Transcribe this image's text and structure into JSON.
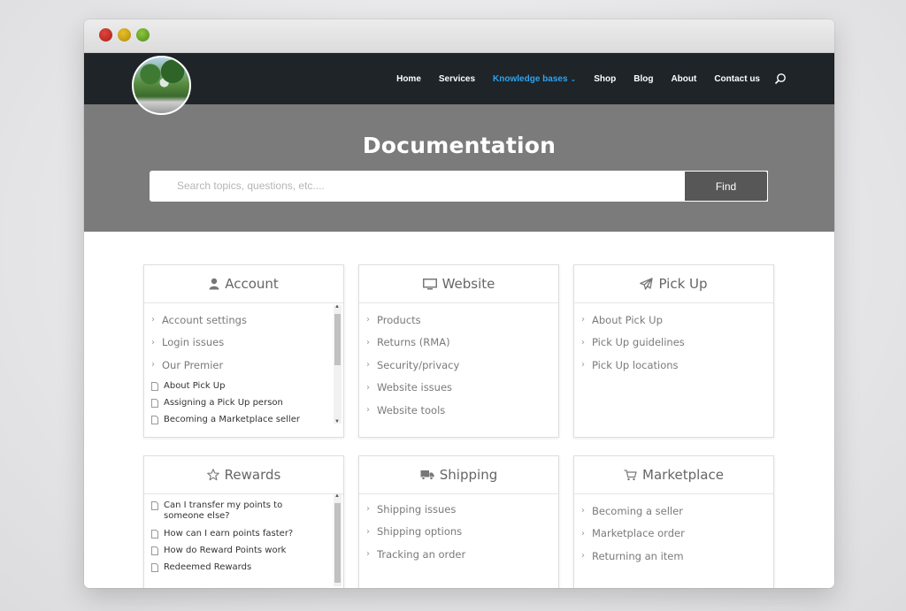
{
  "nav": {
    "items": [
      {
        "label": "Home",
        "active": false
      },
      {
        "label": "Services",
        "active": false
      },
      {
        "label": "Knowledge bases",
        "active": true,
        "has_dropdown": true
      },
      {
        "label": "Shop",
        "active": false
      },
      {
        "label": "Blog",
        "active": false
      },
      {
        "label": "About",
        "active": false
      },
      {
        "label": "Contact us",
        "active": false
      }
    ],
    "active_color": "#2ea3f2",
    "icons": {
      "search": "search-icon",
      "dropdown": "chevron-down-icon"
    }
  },
  "hero": {
    "title": "Documentation",
    "search_placeholder": "Search topics, questions, etc....",
    "find_label": "Find"
  },
  "cards": [
    {
      "title": "Account",
      "icon": "user-icon",
      "topics": [
        "Account settings",
        "Login issues",
        "Our Premier"
      ],
      "articles": [
        "About Pick Up",
        "Assigning a Pick Up person",
        "Becoming a Marketplace seller"
      ]
    },
    {
      "title": "Website",
      "icon": "monitor-icon",
      "topics": [
        "Products",
        "Returns (RMA)",
        "Security/privacy",
        "Website issues",
        "Website tools"
      ],
      "articles": []
    },
    {
      "title": "Pick Up",
      "icon": "paper-plane-icon",
      "topics": [
        "About Pick Up",
        "Pick Up guidelines",
        "Pick Up locations"
      ],
      "articles": []
    },
    {
      "title": "Rewards",
      "icon": "star-icon",
      "topics": [],
      "articles": [
        "Can I transfer my points to someone else?",
        "How can I earn points faster?",
        "How do Reward Points work",
        "Redeemed Rewards"
      ]
    },
    {
      "title": "Shipping",
      "icon": "truck-icon",
      "topics": [
        "Shipping issues",
        "Shipping options",
        "Tracking an order"
      ],
      "articles": []
    },
    {
      "title": "Marketplace",
      "icon": "cart-icon",
      "topics": [
        "Becoming a seller",
        "Marketplace order",
        "Returning an item"
      ],
      "articles": []
    }
  ],
  "colors": {
    "navbar": "#1e2428",
    "hero": "#7b7b7b",
    "find_button": "#575757"
  }
}
